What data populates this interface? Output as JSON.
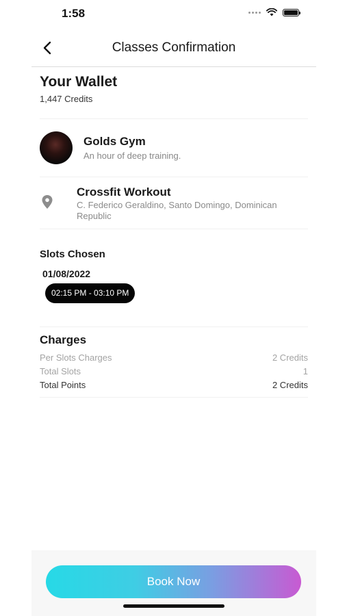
{
  "status_bar": {
    "time": "1:58"
  },
  "header": {
    "title": "Classes Confirmation"
  },
  "wallet": {
    "title": "Your Wallet",
    "credits": "1,447 Credits"
  },
  "gym": {
    "name": "Golds Gym",
    "description": "An hour of deep training."
  },
  "location": {
    "name": "Crossfit Workout",
    "address": "C. Federico Geraldino, Santo Domingo, Dominican Republic"
  },
  "slots": {
    "title": "Slots Chosen",
    "date": "01/08/2022",
    "time_range": "02:15 PM - 03:10 PM"
  },
  "charges": {
    "title": "Charges",
    "rows": [
      {
        "label": "Per Slots Charges",
        "value": "2 Credits"
      },
      {
        "label": "Total Slots",
        "value": "1"
      },
      {
        "label": "Total Points",
        "value": "2 Credits"
      }
    ]
  },
  "footer": {
    "book_label": "Book Now"
  },
  "colors": {
    "button_gradient_start": "#27d9e6",
    "button_gradient_end": "#c85ad2",
    "slot_pill": "#050505"
  },
  "icons": [
    "back-chevron-icon",
    "wifi-icon",
    "battery-icon",
    "location-pin-icon"
  ]
}
